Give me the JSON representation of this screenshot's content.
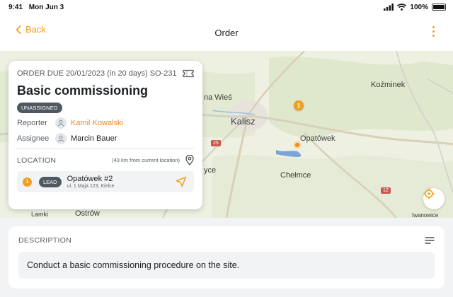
{
  "status_bar": {
    "time": "9:41",
    "date": "Mon Jun 3",
    "battery": "100%"
  },
  "nav": {
    "back_label": "Back",
    "title": "Order"
  },
  "map": {
    "labels": {
      "kalisz": "Kalisz",
      "opatowek": "Opatówek",
      "chelmce": "Chełmce",
      "kozminek": "Koźminek",
      "wies": "na Wieś",
      "yce": "yce",
      "ostrow": "Ostrów",
      "lamki": "Lamki",
      "ivanowice": "Iwanowice"
    },
    "road_25": "25",
    "road_12": "12",
    "pin_number": "1"
  },
  "order": {
    "due": "ORDER DUE 20/01/2023 (in 20 days) SO-231",
    "title": "Basic commissioning",
    "status": "UNASSIGNED",
    "reporter_label": "Reporter",
    "reporter_name": "Kamil Kowalski",
    "assignee_label": "Assignee",
    "assignee_name": "Marcin Bauer",
    "location_label": "LOCATION",
    "location_distance": "(43 km from current location)",
    "location": {
      "number": "1",
      "badge": "LEAD",
      "name": "Opatówek #2",
      "address": "ul. 1 Maja 123, Kielce"
    }
  },
  "description": {
    "label": "DESCRIPTION",
    "text": "Conduct a basic commissioning procedure on the site."
  },
  "colors": {
    "accent": "#f0a020",
    "badge": "#505861",
    "link": "#f08c20"
  }
}
